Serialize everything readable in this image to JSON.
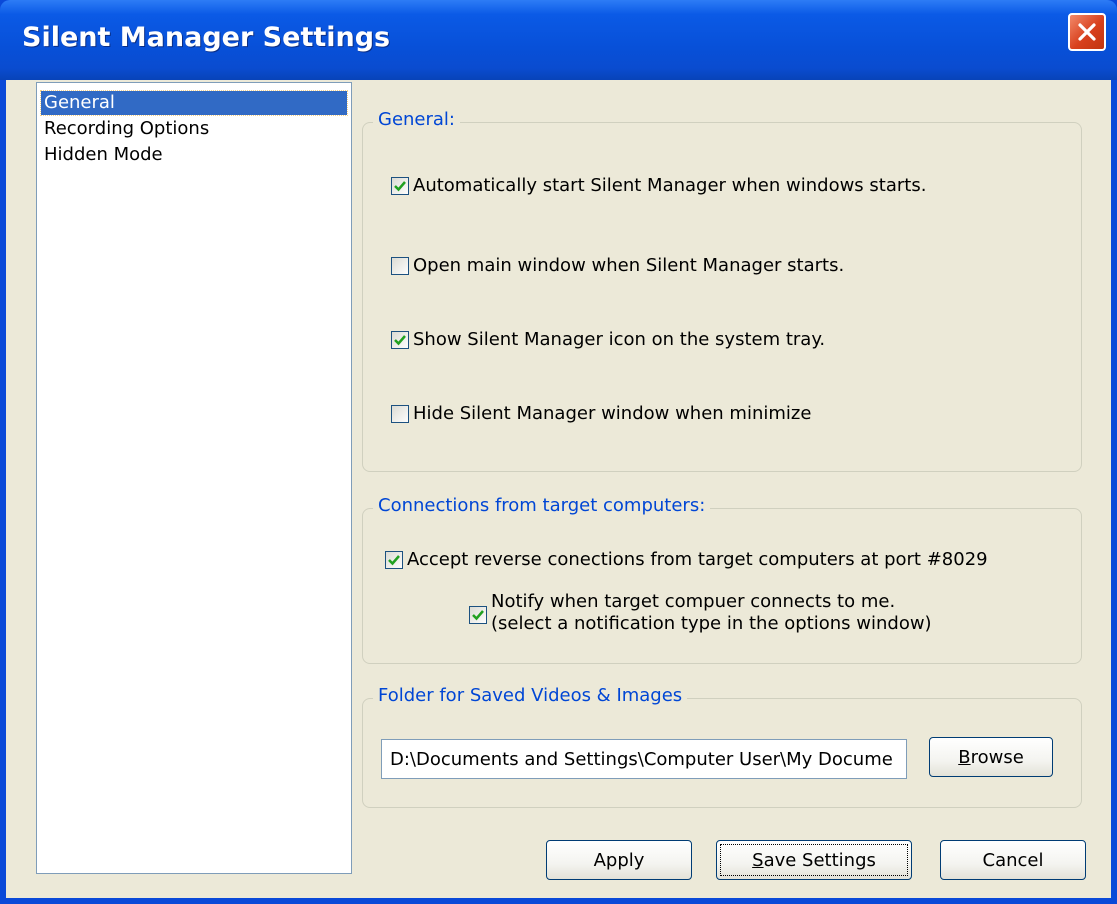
{
  "window": {
    "title": "Silent Manager Settings"
  },
  "nav": {
    "items": [
      "General",
      "Recording Options",
      "Hidden Mode"
    ],
    "selected": "General"
  },
  "general": {
    "label": "General:",
    "options": [
      {
        "label": "Automatically start Silent Manager when windows starts.",
        "checked": true
      },
      {
        "label": "Open main window when Silent Manager starts.",
        "checked": false
      },
      {
        "label": "Show Silent Manager  icon on the system tray.",
        "checked": true
      },
      {
        "label": "Hide Silent Manager window when minimize",
        "checked": false
      }
    ]
  },
  "connections": {
    "label": "Connections from target computers:",
    "accept_label": "Accept reverse conections from target computers at port #8029",
    "accept_checked": true,
    "notify_line1": "Notify when target compuer connects to me.",
    "notify_line2": "(select a notification type in the options window)",
    "notify_checked": true
  },
  "folder": {
    "label": "Folder for Saved Videos & Images",
    "path": "D:\\Documents and Settings\\Computer User\\My Docume",
    "browse_rest": "rowse",
    "browse_accel": "B"
  },
  "buttons": {
    "apply": "Apply",
    "save_accel": "S",
    "save_rest": "ave Settings",
    "cancel": "Cancel"
  },
  "colors": {
    "titlebar": "#0a4cd0",
    "dialog_bg": "#ece9d8",
    "group_label": "#0046d5",
    "selection": "#316ac5",
    "close": "#d8401d"
  }
}
